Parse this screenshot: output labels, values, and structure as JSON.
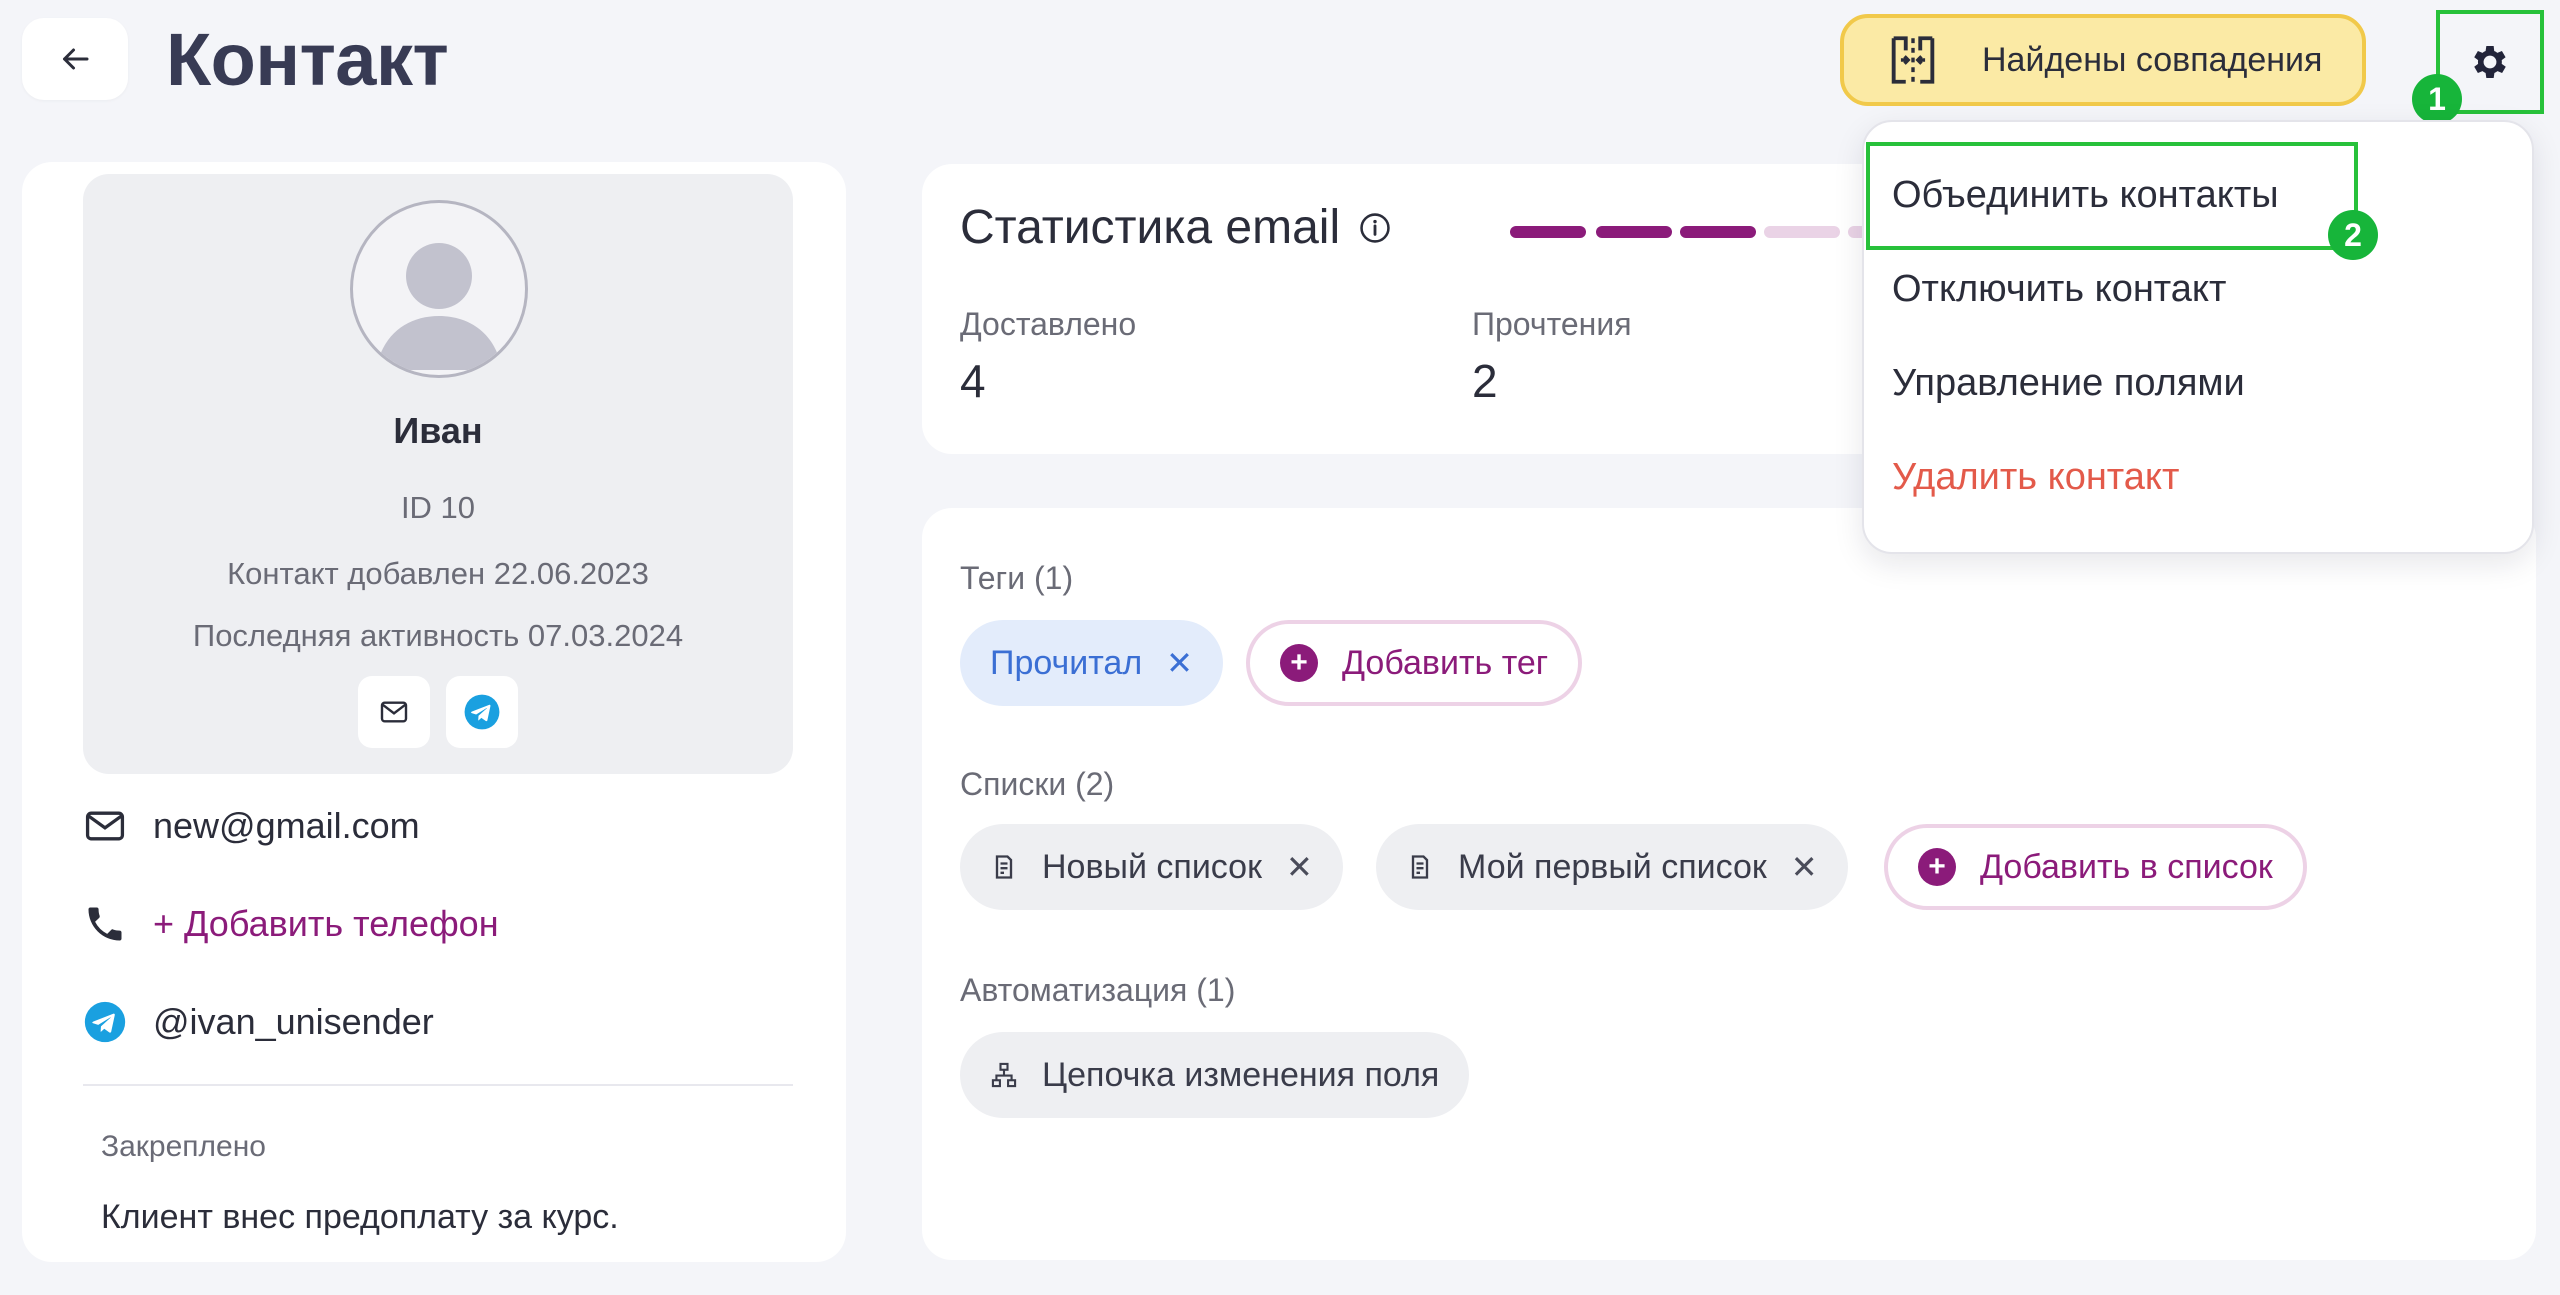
{
  "header": {
    "title": "Контакт",
    "duplicates_label": "Найдены совпадения"
  },
  "badges": {
    "one": "1",
    "two": "2"
  },
  "profile": {
    "name": "Иван",
    "id_text": "ID 10",
    "added_text": "Контакт добавлен 22.06.2023",
    "activity_text": "Последняя активность 07.03.2024"
  },
  "contacts": {
    "email": "new@gmail.com",
    "add_phone": "+ Добавить телефон",
    "telegram": "@ivan_unisender"
  },
  "pinned": {
    "label": "Закреплено",
    "text": "Клиент внес предоплату за курс."
  },
  "stats": {
    "title": "Статистика email",
    "delivered_label": "Доставлено",
    "delivered_value": "4",
    "reads_label": "Прочтения",
    "reads_value": "2"
  },
  "tags": {
    "label": "Теги (1)",
    "items": [
      "Прочитал"
    ],
    "add_label": "Добавить тег"
  },
  "lists": {
    "label": "Списки (2)",
    "items": [
      "Новый список",
      "Мой первый список"
    ],
    "add_label": "Добавить в список"
  },
  "automation": {
    "label": "Автоматизация (1)",
    "items": [
      "Цепочка изменения поля"
    ]
  },
  "menu": {
    "merge": "Объединить контакты",
    "disable": "Отключить контакт",
    "fields": "Управление полями",
    "delete": "Удалить контакт"
  },
  "colors": {
    "accent": "#8b1b7a",
    "highlight": "#27c13a",
    "danger": "#e35a4a",
    "warning_bg": "#fbeaa5",
    "telegram": "#1aa0e0"
  }
}
